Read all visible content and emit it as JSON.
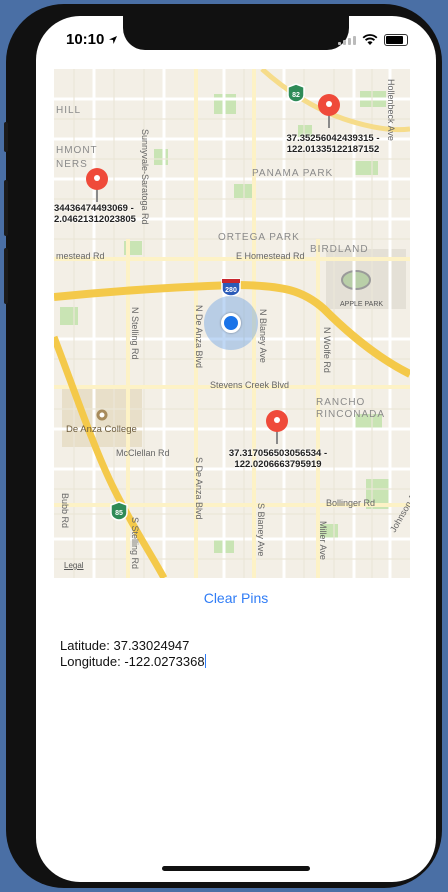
{
  "status_bar": {
    "time": "10:10",
    "location_icon": "location-arrow-icon"
  },
  "map": {
    "area_labels": [
      "PANAMA PARK",
      "ORTEGA PARK",
      "BIRDLAND",
      "RANCHO",
      "RINCONADA",
      "APPLE PARK"
    ],
    "street_labels": [
      "Sunnyvale-Saratoga Rd",
      "E Homestead Rd",
      "mestead Rd",
      "N De Anza Blvd",
      "N Blaney Ave",
      "N Wolfe Rd",
      "N Stelling Rd",
      "Stevens Creek Blvd",
      "McClellan Rd",
      "S De Anza Blvd",
      "S Blaney Ave",
      "Bollinger Rd",
      "Miller Ave",
      "Johnson Ave",
      "Bubb Rd",
      "S Stelling Rd",
      "Hollenbeck Ave"
    ],
    "partial_labels": [
      "HILL",
      "HMONT",
      "NERS"
    ],
    "poi_label": "De Anza College",
    "highway_shields": [
      "280",
      "85",
      "82"
    ],
    "pins": [
      {
        "caption_line1": "37.35256042439315 -",
        "caption_line2": "122.01335122187152"
      },
      {
        "caption_line1": "34436474493069 -",
        "caption_line2": "2.04621312023805"
      },
      {
        "caption_line1": "37.317056503056534 -",
        "caption_line2": "122.0206663795919"
      }
    ],
    "legal": "Legal"
  },
  "controls": {
    "clear_pins_label": "Clear Pins"
  },
  "location": {
    "latitude_text": "Latitude: 37.33024947",
    "longitude_text": "Longitude: -122.0273368"
  }
}
